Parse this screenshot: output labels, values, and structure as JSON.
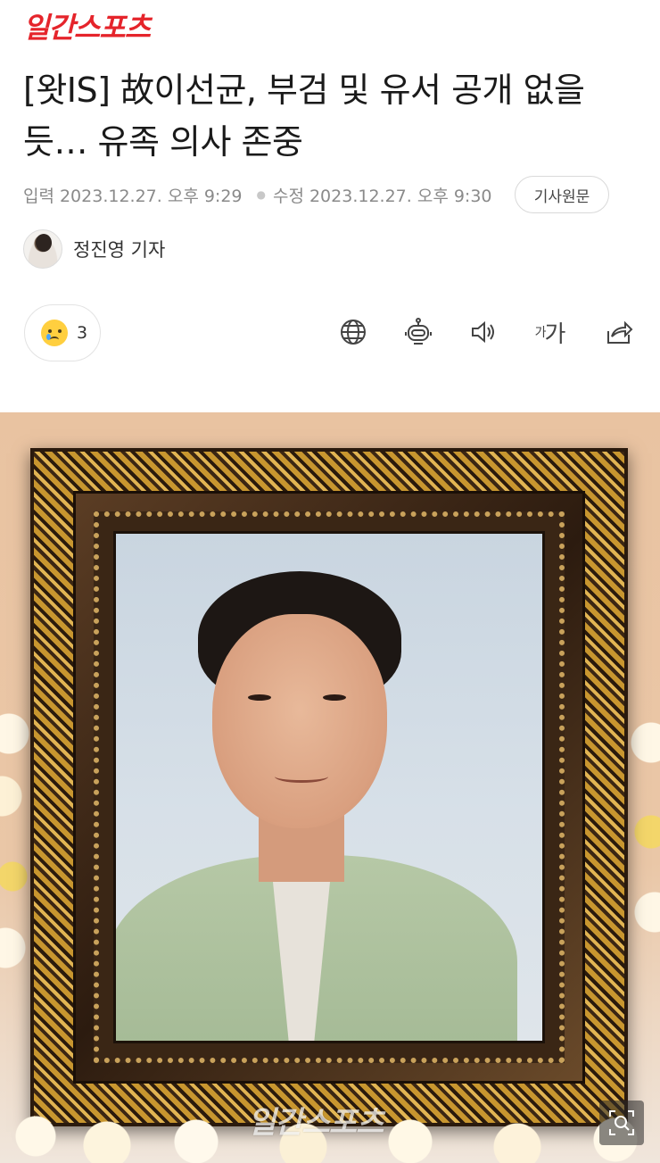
{
  "header": {
    "logo": "일간스포츠"
  },
  "article": {
    "title": "[왓IS] 故이선균, 부검 및 유서 공개 없을 듯… 유족 의사 존중",
    "published_label": "입력",
    "published": "2023.12.27. 오후 9:29",
    "modified_label": "수정",
    "modified": "2023.12.27. 오후 9:30",
    "original_button": "기사원문",
    "reporter": "정진영 기자"
  },
  "reactions": {
    "icon": "sad-face-icon",
    "count": "3"
  },
  "toolbar": {
    "icons": [
      "globe-icon",
      "robot-icon",
      "speaker-icon",
      "font-size-icon",
      "share-icon"
    ],
    "font_small": "가",
    "font_large": "가"
  },
  "photo": {
    "watermark": "일간스포츠",
    "zoom_icon": "zoom-icon"
  },
  "colors": {
    "brand": "#e5242b",
    "meta_text": "#8a8a8a"
  }
}
